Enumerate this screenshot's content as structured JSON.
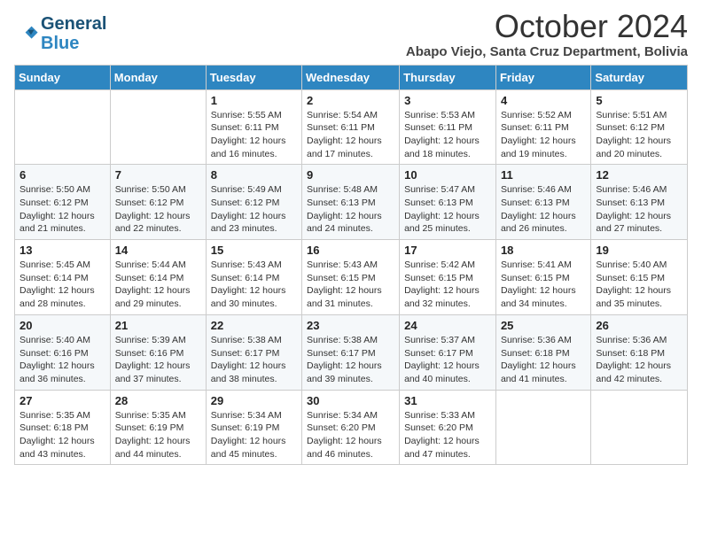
{
  "logo": {
    "line1": "General",
    "line2": "Blue"
  },
  "title": "October 2024",
  "subtitle": "Abapo Viejo, Santa Cruz Department, Bolivia",
  "days_of_week": [
    "Sunday",
    "Monday",
    "Tuesday",
    "Wednesday",
    "Thursday",
    "Friday",
    "Saturday"
  ],
  "weeks": [
    [
      {
        "day": "",
        "info": ""
      },
      {
        "day": "",
        "info": ""
      },
      {
        "day": "1",
        "info": "Sunrise: 5:55 AM\nSunset: 6:11 PM\nDaylight: 12 hours and 16 minutes."
      },
      {
        "day": "2",
        "info": "Sunrise: 5:54 AM\nSunset: 6:11 PM\nDaylight: 12 hours and 17 minutes."
      },
      {
        "day": "3",
        "info": "Sunrise: 5:53 AM\nSunset: 6:11 PM\nDaylight: 12 hours and 18 minutes."
      },
      {
        "day": "4",
        "info": "Sunrise: 5:52 AM\nSunset: 6:11 PM\nDaylight: 12 hours and 19 minutes."
      },
      {
        "day": "5",
        "info": "Sunrise: 5:51 AM\nSunset: 6:12 PM\nDaylight: 12 hours and 20 minutes."
      }
    ],
    [
      {
        "day": "6",
        "info": "Sunrise: 5:50 AM\nSunset: 6:12 PM\nDaylight: 12 hours and 21 minutes."
      },
      {
        "day": "7",
        "info": "Sunrise: 5:50 AM\nSunset: 6:12 PM\nDaylight: 12 hours and 22 minutes."
      },
      {
        "day": "8",
        "info": "Sunrise: 5:49 AM\nSunset: 6:12 PM\nDaylight: 12 hours and 23 minutes."
      },
      {
        "day": "9",
        "info": "Sunrise: 5:48 AM\nSunset: 6:13 PM\nDaylight: 12 hours and 24 minutes."
      },
      {
        "day": "10",
        "info": "Sunrise: 5:47 AM\nSunset: 6:13 PM\nDaylight: 12 hours and 25 minutes."
      },
      {
        "day": "11",
        "info": "Sunrise: 5:46 AM\nSunset: 6:13 PM\nDaylight: 12 hours and 26 minutes."
      },
      {
        "day": "12",
        "info": "Sunrise: 5:46 AM\nSunset: 6:13 PM\nDaylight: 12 hours and 27 minutes."
      }
    ],
    [
      {
        "day": "13",
        "info": "Sunrise: 5:45 AM\nSunset: 6:14 PM\nDaylight: 12 hours and 28 minutes."
      },
      {
        "day": "14",
        "info": "Sunrise: 5:44 AM\nSunset: 6:14 PM\nDaylight: 12 hours and 29 minutes."
      },
      {
        "day": "15",
        "info": "Sunrise: 5:43 AM\nSunset: 6:14 PM\nDaylight: 12 hours and 30 minutes."
      },
      {
        "day": "16",
        "info": "Sunrise: 5:43 AM\nSunset: 6:15 PM\nDaylight: 12 hours and 31 minutes."
      },
      {
        "day": "17",
        "info": "Sunrise: 5:42 AM\nSunset: 6:15 PM\nDaylight: 12 hours and 32 minutes."
      },
      {
        "day": "18",
        "info": "Sunrise: 5:41 AM\nSunset: 6:15 PM\nDaylight: 12 hours and 34 minutes."
      },
      {
        "day": "19",
        "info": "Sunrise: 5:40 AM\nSunset: 6:15 PM\nDaylight: 12 hours and 35 minutes."
      }
    ],
    [
      {
        "day": "20",
        "info": "Sunrise: 5:40 AM\nSunset: 6:16 PM\nDaylight: 12 hours and 36 minutes."
      },
      {
        "day": "21",
        "info": "Sunrise: 5:39 AM\nSunset: 6:16 PM\nDaylight: 12 hours and 37 minutes."
      },
      {
        "day": "22",
        "info": "Sunrise: 5:38 AM\nSunset: 6:17 PM\nDaylight: 12 hours and 38 minutes."
      },
      {
        "day": "23",
        "info": "Sunrise: 5:38 AM\nSunset: 6:17 PM\nDaylight: 12 hours and 39 minutes."
      },
      {
        "day": "24",
        "info": "Sunrise: 5:37 AM\nSunset: 6:17 PM\nDaylight: 12 hours and 40 minutes."
      },
      {
        "day": "25",
        "info": "Sunrise: 5:36 AM\nSunset: 6:18 PM\nDaylight: 12 hours and 41 minutes."
      },
      {
        "day": "26",
        "info": "Sunrise: 5:36 AM\nSunset: 6:18 PM\nDaylight: 12 hours and 42 minutes."
      }
    ],
    [
      {
        "day": "27",
        "info": "Sunrise: 5:35 AM\nSunset: 6:18 PM\nDaylight: 12 hours and 43 minutes."
      },
      {
        "day": "28",
        "info": "Sunrise: 5:35 AM\nSunset: 6:19 PM\nDaylight: 12 hours and 44 minutes."
      },
      {
        "day": "29",
        "info": "Sunrise: 5:34 AM\nSunset: 6:19 PM\nDaylight: 12 hours and 45 minutes."
      },
      {
        "day": "30",
        "info": "Sunrise: 5:34 AM\nSunset: 6:20 PM\nDaylight: 12 hours and 46 minutes."
      },
      {
        "day": "31",
        "info": "Sunrise: 5:33 AM\nSunset: 6:20 PM\nDaylight: 12 hours and 47 minutes."
      },
      {
        "day": "",
        "info": ""
      },
      {
        "day": "",
        "info": ""
      }
    ]
  ]
}
